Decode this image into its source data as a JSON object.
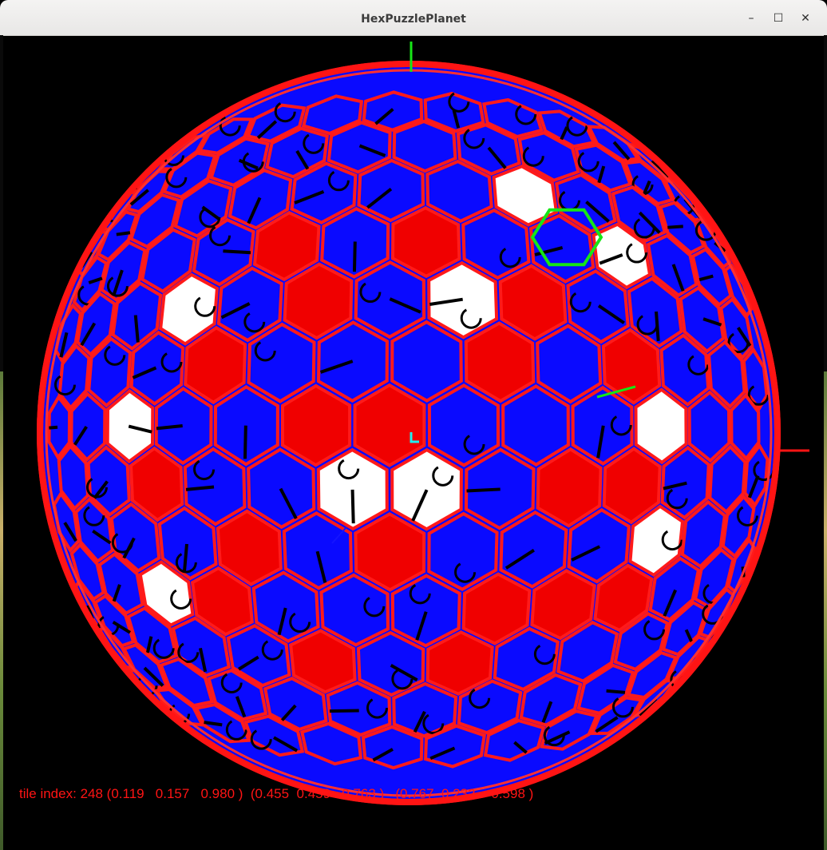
{
  "window": {
    "title": "HexPuzzlePlanet",
    "controls": {
      "minimize": "–",
      "maximize": "☐",
      "close": "✕"
    }
  },
  "scene": {
    "tile_colors": {
      "blue": "#0a0aff",
      "red": "#f00000",
      "white": "#ffffff",
      "border": "#ff1a1a",
      "selected": "#16e616"
    },
    "background": "#000000",
    "axis_colors": {
      "y": "#16e616",
      "x": "#ff1414",
      "z": "#1ef0f0"
    }
  },
  "status": {
    "label": "tile index:",
    "index": "248",
    "vec1": "(0.119   0.157   0.980 )",
    "vec2": "(0.455  0.459   0.763 )",
    "vec3": "(0.767  0.232   -0.598 )"
  }
}
